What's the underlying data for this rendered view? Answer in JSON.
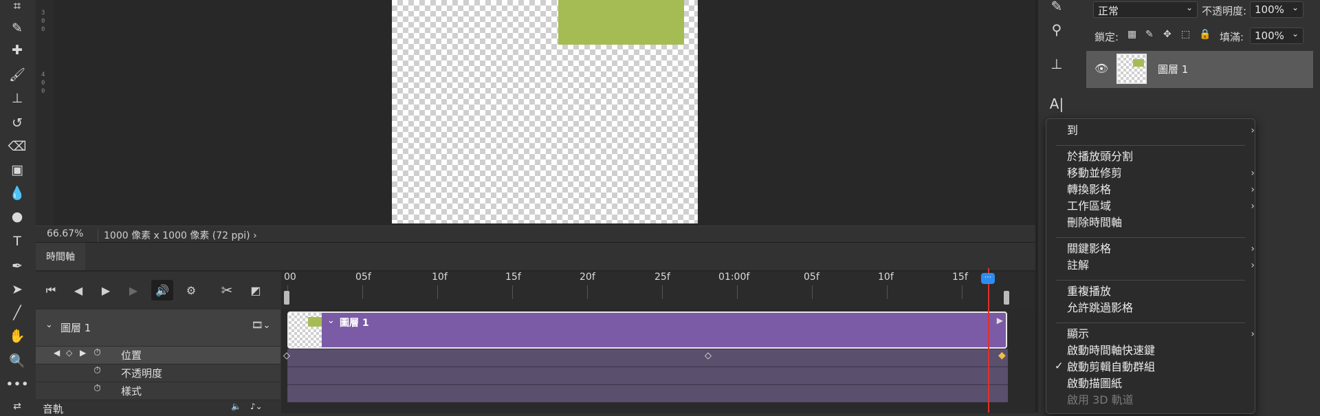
{
  "canvas": {
    "zoom": "66.67%",
    "doc_info": "1000 像素 x 1000 像素 (72 ppi)",
    "doc_info_chevron": "›"
  },
  "ruler": {
    "marks": [
      "3",
      "0",
      "0",
      "4",
      "0",
      "0"
    ]
  },
  "timeline": {
    "tab_label": "時間軸",
    "ticks": [
      "00",
      "05f",
      "10f",
      "15f",
      "20f",
      "25f",
      "01:00f",
      "05f",
      "10f",
      "15f"
    ],
    "layer_name": "圖層 1",
    "clip_label": "圖層 1",
    "props": [
      "位置",
      "不透明度",
      "樣式"
    ],
    "audio_label": "音軌",
    "add": "+"
  },
  "layers_panel": {
    "blend_mode": "正常",
    "opacity_label": "不透明度:",
    "opacity_value": "100%",
    "lock_label": "鎖定:",
    "fill_label": "填滿:",
    "fill_value": "100%",
    "layer_name": "圖層 1"
  },
  "context_menu": {
    "sections": [
      [
        {
          "label": "到",
          "submenu": true
        }
      ],
      [
        {
          "label": "於播放頭分割"
        },
        {
          "label": "移動並修剪",
          "submenu": true
        },
        {
          "label": "轉換影格",
          "submenu": true
        },
        {
          "label": "工作區域",
          "submenu": true
        },
        {
          "label": "刪除時間軸"
        }
      ],
      [
        {
          "label": "關鍵影格",
          "submenu": true
        },
        {
          "label": "註解",
          "submenu": true
        }
      ],
      [
        {
          "label": "重複播放"
        },
        {
          "label": "允許跳過影格"
        }
      ],
      [
        {
          "label": "顯示",
          "submenu": true
        },
        {
          "label": "啟動時間軸快速鍵"
        },
        {
          "label": "啟動剪輯自動群組",
          "checked": true
        },
        {
          "label": "啟動描圖紙"
        },
        {
          "label": "啟用 3D 軌道",
          "disabled": true
        }
      ]
    ]
  },
  "colors": {
    "accent_green": "#a5bc55",
    "clip_purple": "#7b5aa6",
    "playhead_red": "#e0302b",
    "playhead_blue": "#2e8df0"
  }
}
